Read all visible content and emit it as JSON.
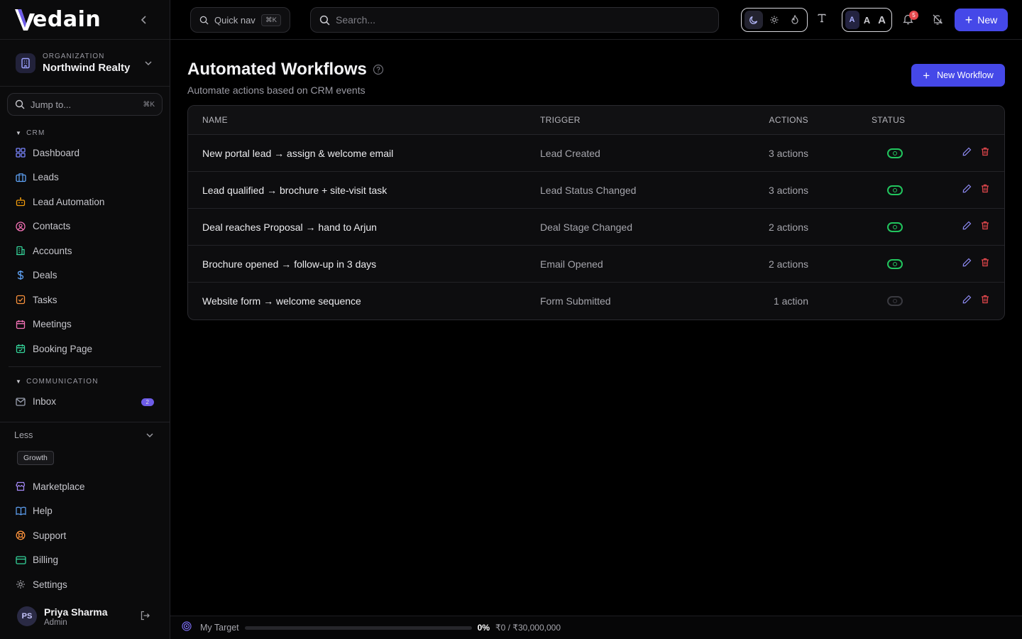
{
  "brand": {
    "name": "edain",
    "accent": "#4548e8"
  },
  "sidebar": {
    "org": {
      "label": "ORGANIZATION",
      "name": "Northwind Realty"
    },
    "jump": {
      "placeholder": "Jump to...",
      "shortcut": "⌘K"
    },
    "crm": {
      "title": "CRM",
      "items": [
        {
          "label": "Dashboard",
          "icon": "grid-icon"
        },
        {
          "label": "Leads",
          "icon": "briefcase-icon"
        },
        {
          "label": "Lead Automation",
          "icon": "robot-icon"
        },
        {
          "label": "Contacts",
          "icon": "user-circle-icon"
        },
        {
          "label": "Accounts",
          "icon": "building-icon"
        },
        {
          "label": "Deals",
          "icon": "dollar-icon"
        },
        {
          "label": "Tasks",
          "icon": "checkbox-icon"
        },
        {
          "label": "Meetings",
          "icon": "calendar-icon"
        },
        {
          "label": "Booking Page",
          "icon": "calendar-check-icon"
        }
      ]
    },
    "communication": {
      "title": "COMMUNICATION",
      "items": [
        {
          "label": "Inbox",
          "icon": "mail-icon",
          "badge": "2"
        }
      ]
    },
    "less_label": "Less",
    "plan_badge": "Growth",
    "lower_items": [
      {
        "label": "Marketplace",
        "icon": "store-icon"
      },
      {
        "label": "Help",
        "icon": "book-icon"
      },
      {
        "label": "Support",
        "icon": "lifebuoy-icon"
      },
      {
        "label": "Billing",
        "icon": "credit-card-icon"
      },
      {
        "label": "Settings",
        "icon": "gear-icon"
      }
    ],
    "user": {
      "initials": "PS",
      "name": "Priya Sharma",
      "role": "Admin"
    }
  },
  "topbar": {
    "quicknav_label": "Quick nav",
    "quicknav_shortcut": "⌘K",
    "search_placeholder": "Search...",
    "size_options": [
      "A",
      "A",
      "A"
    ],
    "notification_count": "5",
    "new_label": "New"
  },
  "page": {
    "title": "Automated Workflows",
    "subtitle": "Automate actions based on CRM events",
    "new_workflow_label": "New Workflow"
  },
  "table": {
    "headers": {
      "name": "NAME",
      "trigger": "TRIGGER",
      "actions": "ACTIONS",
      "status": "STATUS"
    },
    "rows": [
      {
        "name": "New portal lead → assign & welcome email",
        "trigger": "Lead Created",
        "actions": "3 actions",
        "active": true
      },
      {
        "name": "Lead qualified → brochure + site-visit task",
        "trigger": "Lead Status Changed",
        "actions": "3 actions",
        "active": true
      },
      {
        "name": "Deal reaches Proposal → hand to Arjun",
        "trigger": "Deal Stage Changed",
        "actions": "2 actions",
        "active": true
      },
      {
        "name": "Brochure opened → follow-up in 3 days",
        "trigger": "Email Opened",
        "actions": "2 actions",
        "active": true
      },
      {
        "name": "Website form → welcome sequence",
        "trigger": "Form Submitted",
        "actions": "1 action",
        "active": false
      }
    ]
  },
  "footer": {
    "target_label": "My Target",
    "percent": "0%",
    "progress_fraction": 0,
    "amount": "₹0 / ₹30,000,000"
  }
}
